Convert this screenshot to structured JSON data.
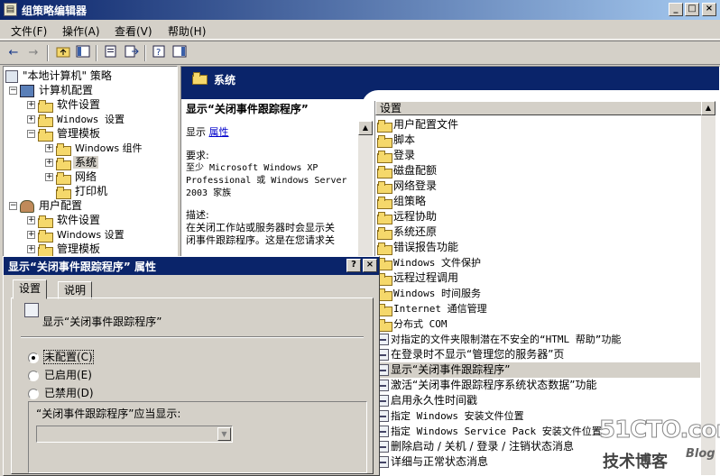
{
  "window": {
    "title": "组策略编辑器",
    "icon": "policy-editor-icon",
    "controls": [
      "_",
      "□",
      "×"
    ]
  },
  "menu": [
    {
      "label": "文件(F)"
    },
    {
      "label": "操作(A)"
    },
    {
      "label": "查看(V)"
    },
    {
      "label": "帮助(H)"
    }
  ],
  "toolbar": {
    "back_icon": "←",
    "forward_icon": "→",
    "icons": [
      "up-folder-icon",
      "show-hide-tree-icon",
      "properties-icon",
      "export-list-icon",
      "help-icon",
      "show-hide-action-pane-icon"
    ]
  },
  "tree": {
    "root": "\"本地计算机\" 策略",
    "items": [
      {
        "label": "计算机配置"
      },
      {
        "label": "软件设置"
      },
      {
        "label": "Windows 设置"
      },
      {
        "label": "管理模板"
      },
      {
        "label": "Windows 组件"
      },
      {
        "label": "系统"
      },
      {
        "label": "网络"
      },
      {
        "label": "打印机"
      },
      {
        "label": "用户配置"
      },
      {
        "label": "软件设置"
      },
      {
        "label": "Windows 设置"
      },
      {
        "label": "管理模板"
      }
    ]
  },
  "right_pane": {
    "header_title": "系统",
    "description": {
      "heading": "显示“关闭事件跟踪程序”",
      "show_prefix": "显示",
      "properties_link": "属性",
      "requirement_label": "要求:",
      "requirement_line1": "至少 Microsoft Windows XP",
      "requirement_line2": "Professional 或 Windows Server",
      "requirement_line3": "2003 家族",
      "desc_label": "描述:",
      "desc_line1": "在关闭工作站或服务器时会显示关",
      "desc_line2": "闭事件跟踪程序。这是在您请求关"
    },
    "list_header": "设置",
    "list_items": [
      {
        "label": "用户配置文件",
        "kind": "folder"
      },
      {
        "label": "脚本",
        "kind": "folder"
      },
      {
        "label": "登录",
        "kind": "folder"
      },
      {
        "label": "磁盘配额",
        "kind": "folder"
      },
      {
        "label": "网络登录",
        "kind": "folder"
      },
      {
        "label": "组策略",
        "kind": "folder"
      },
      {
        "label": "远程协助",
        "kind": "folder"
      },
      {
        "label": "系统还原",
        "kind": "folder"
      },
      {
        "label": "错误报告功能",
        "kind": "folder"
      },
      {
        "label": "Windows 文件保护",
        "kind": "folder"
      },
      {
        "label": "远程过程调用",
        "kind": "folder"
      },
      {
        "label": "Windows 时间服务",
        "kind": "folder"
      },
      {
        "label": "Internet 通信管理",
        "kind": "folder"
      },
      {
        "label": "分布式 COM",
        "kind": "folder"
      },
      {
        "label": "对指定的文件夹限制潜在不安全的“HTML 帮助”功能",
        "kind": "policy"
      },
      {
        "label": "在登录时不显示“管理您的服务器”页",
        "kind": "policy"
      },
      {
        "label": "显示“关闭事件跟踪程序”",
        "kind": "policy",
        "selected": true
      },
      {
        "label": "激活“关闭事件跟踪程序系统状态数据”功能",
        "kind": "policy"
      },
      {
        "label": "启用永久性时间戳",
        "kind": "policy"
      },
      {
        "label": "指定 Windows 安装文件位置",
        "kind": "policy"
      },
      {
        "label": "指定 Windows Service Pack 安装文件位置",
        "kind": "policy"
      },
      {
        "label": "删除启动 / 关机 / 登录 / 注销状态消息",
        "kind": "policy"
      },
      {
        "label": "详细与正常状态消息",
        "kind": "policy"
      }
    ]
  },
  "dialog": {
    "title": "显示“关闭事件跟踪程序” 属性",
    "help_btn": "?",
    "close_btn": "×",
    "tabs": [
      {
        "label": "设置"
      },
      {
        "label": "说明"
      }
    ],
    "setting_name": "显示“关闭事件跟踪程序”",
    "radios": [
      {
        "label": "未配置(C)",
        "checked": true
      },
      {
        "label": "已启用(E)",
        "checked": false
      },
      {
        "label": "已禁用(D)",
        "checked": false
      }
    ],
    "option_label": "“关闭事件跟踪程序”应当显示:",
    "combo_value": "",
    "combo_arrow": "▼"
  },
  "watermark": {
    "big": "51CTO.com",
    "small": "技术博客",
    "blog": "Blog"
  },
  "colors": {
    "title_active": "#0a246a",
    "face": "#d4d0c8",
    "folder": "#f5d86b",
    "link": "#0000cc"
  }
}
